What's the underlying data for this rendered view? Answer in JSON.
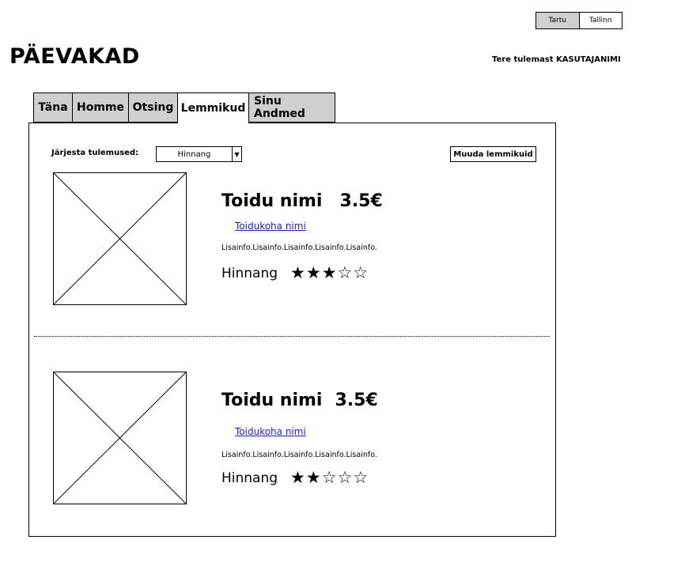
{
  "city_toggle": {
    "active": "Tartu",
    "other": "Tallinn"
  },
  "app_title": "PÄEVAKAD",
  "welcome": "Tere tulemast KASUTAJANIMI",
  "tabs": [
    {
      "label": "Täna"
    },
    {
      "label": "Homme"
    },
    {
      "label": "Otsing"
    },
    {
      "label": "Lemmikud",
      "active": true
    },
    {
      "label": "Sinu Andmed"
    }
  ],
  "sort": {
    "label": "Järjesta tulemused:",
    "value": "Hinnang"
  },
  "edit_favorites_label": "Muuda lemmikuid",
  "items": [
    {
      "food_name": "Toidu nimi",
      "price": "3.5€",
      "place": "Toidukoha nimi",
      "extra_info": "Lisainfo.Lisainfo.Lisainfo.Lisainfo.Lisainfo.",
      "rating_label": "Hinnang",
      "rating": 3,
      "rating_max": 5
    },
    {
      "food_name": "Toidu nimi",
      "price": "3.5€",
      "place": "Toidukoha nimi",
      "extra_info": "Lisainfo.Lisainfo.Lisainfo.Lisainfo.Lisainfo.",
      "rating_label": "Hinnang",
      "rating": 2,
      "rating_max": 5
    }
  ]
}
